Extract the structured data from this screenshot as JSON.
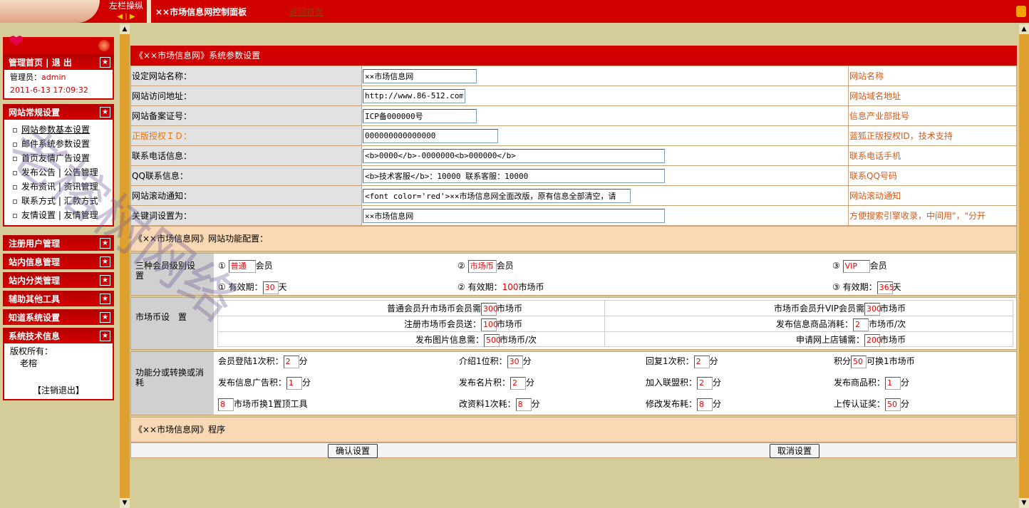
{
  "topbar": {
    "toggle_label": "左栏操纵",
    "toggle_arrows": "◀ | ▶",
    "title": "××市场信息网控制面板",
    "home_link": "返回首页"
  },
  "sidebar": {
    "head_home": "管理首页 | 退 出",
    "admin_label": "管理员：",
    "admin_name": "admin",
    "datetime": "2011-6-13 17:09:32",
    "general_head": "网站常规设置",
    "general_items": [
      "网站参数基本设置",
      "邮件系统参数设置",
      "首页友情广告设置",
      "发布公告 | 公告管理",
      "发布资讯 | 资讯管理",
      "联系方式 | 汇款方式",
      "友情设置 | 友情管理"
    ],
    "sections": [
      "注册用户管理",
      "站内信息管理",
      "站内分类管理",
      "辅助其他工具",
      "知道系统设置",
      "系统技术信息"
    ],
    "copyright_label": "版权所有：",
    "copyright_name": "老榕",
    "logout": "【注销退出】"
  },
  "main": {
    "section1_title": "《××市场信息网》系统参数设置",
    "params": [
      {
        "label": "设定网站名称：",
        "value": "××市场信息网",
        "hint": "网站名称"
      },
      {
        "label": "网站访问地址：",
        "value": "http://www.86-512.com/",
        "hint": "网站域名地址"
      },
      {
        "label": "网站备案证号：",
        "value": "ICP备000000号",
        "hint": "信息产业部批号"
      },
      {
        "label": "正版授权ＩＤ：",
        "value": "000000000000000",
        "hint": "蓝狐正版授权ID，技术支持"
      },
      {
        "label": "联系电话信息：",
        "value": "<b>0000</b>-0000000<b>000000</b>",
        "hint": "联系电话手机"
      },
      {
        "label": "QQ联系信息：",
        "value": "<b>技术客服</b>：10000 联系客服：10000",
        "hint": "联系QQ号码"
      },
      {
        "label": "网站滚动通知：",
        "value": "<font color='red'>××市场信息网全面改版，原有信息全部清空，请",
        "hint": "网站滚动通知"
      },
      {
        "label": "关键词设置为：",
        "value": "××市场信息网",
        "hint": "方便搜索引擎收录，中间用\"，\"分开"
      }
    ],
    "section2_title": "《××市场信息网》网站功能配置：",
    "member": {
      "label": "三种会员级别设　置",
      "m1_prefix": "①",
      "m1_value": "普通",
      "m1_suffix": "会员",
      "m2_prefix": "②",
      "m2_value": "市场币",
      "m2_suffix": "会员",
      "m3_prefix": "③",
      "m3_value": "VIP",
      "m3_suffix": "会员",
      "v1_text": "① 有效期：",
      "v1_value": "30",
      "v1_unit": "天",
      "v2_text": "② 有效期：",
      "v2_value": "100",
      "v2_unit": "市场币",
      "v3_text": "③ 有效期：",
      "v3_value": "365",
      "v3_unit": "天"
    },
    "coin": {
      "label": "市场币设　置",
      "rows": [
        {
          "l_text": "普通会员升市场币会员需",
          "l_value": "300",
          "l_unit": "市场币",
          "r_text": "市场币会员升VIP会员需",
          "r_value": "300",
          "r_unit": "市场币"
        },
        {
          "l_text": "注册市场币会员送：",
          "l_value": "100",
          "l_unit": "市场币",
          "r_text": "发布信息商品消耗：",
          "r_value": "2",
          "r_unit": "市场币/次"
        },
        {
          "l_text": "发布图片信息需：",
          "l_value": "500",
          "l_unit": "市场币/次",
          "r_text": "申请网上店铺需：",
          "r_value": "200",
          "r_unit": "市场币"
        }
      ]
    },
    "points": {
      "label": "功能分或转换或消耗",
      "items": [
        {
          "text": "会员登陆1次积：",
          "value": "2",
          "unit": "分"
        },
        {
          "text": "介绍1位积：",
          "value": "30",
          "unit": "分"
        },
        {
          "text": "回复1次积：",
          "value": "2",
          "unit": "分"
        },
        {
          "text": "积分",
          "value": "50",
          "unit": "可换1市场币"
        },
        {
          "text": "发布信息广告积：",
          "value": "1",
          "unit": "分"
        },
        {
          "text": "发布名片积：",
          "value": "2",
          "unit": "分"
        },
        {
          "text": "加入联盟积：",
          "value": "2",
          "unit": "分"
        },
        {
          "text": "发布商品积：",
          "value": "1",
          "unit": "分"
        },
        {
          "text": "",
          "value": "8",
          "unit": "市场币换1置顶工具"
        },
        {
          "text": "改资料1次耗：",
          "value": "8",
          "unit": "分"
        },
        {
          "text": "修改发布耗：",
          "value": "8",
          "unit": "分"
        },
        {
          "text": "上传认证奖：",
          "value": "50",
          "unit": "分"
        }
      ]
    },
    "section3_title": "《××市场信息网》程序",
    "confirm_button": "确认设置",
    "cancel_button": "取消设置"
  },
  "watermark": "老榕树网络",
  "colors": {
    "accent_red": "#d10000",
    "hint_orange": "#d45a1a",
    "bg": "#d4cc99"
  }
}
